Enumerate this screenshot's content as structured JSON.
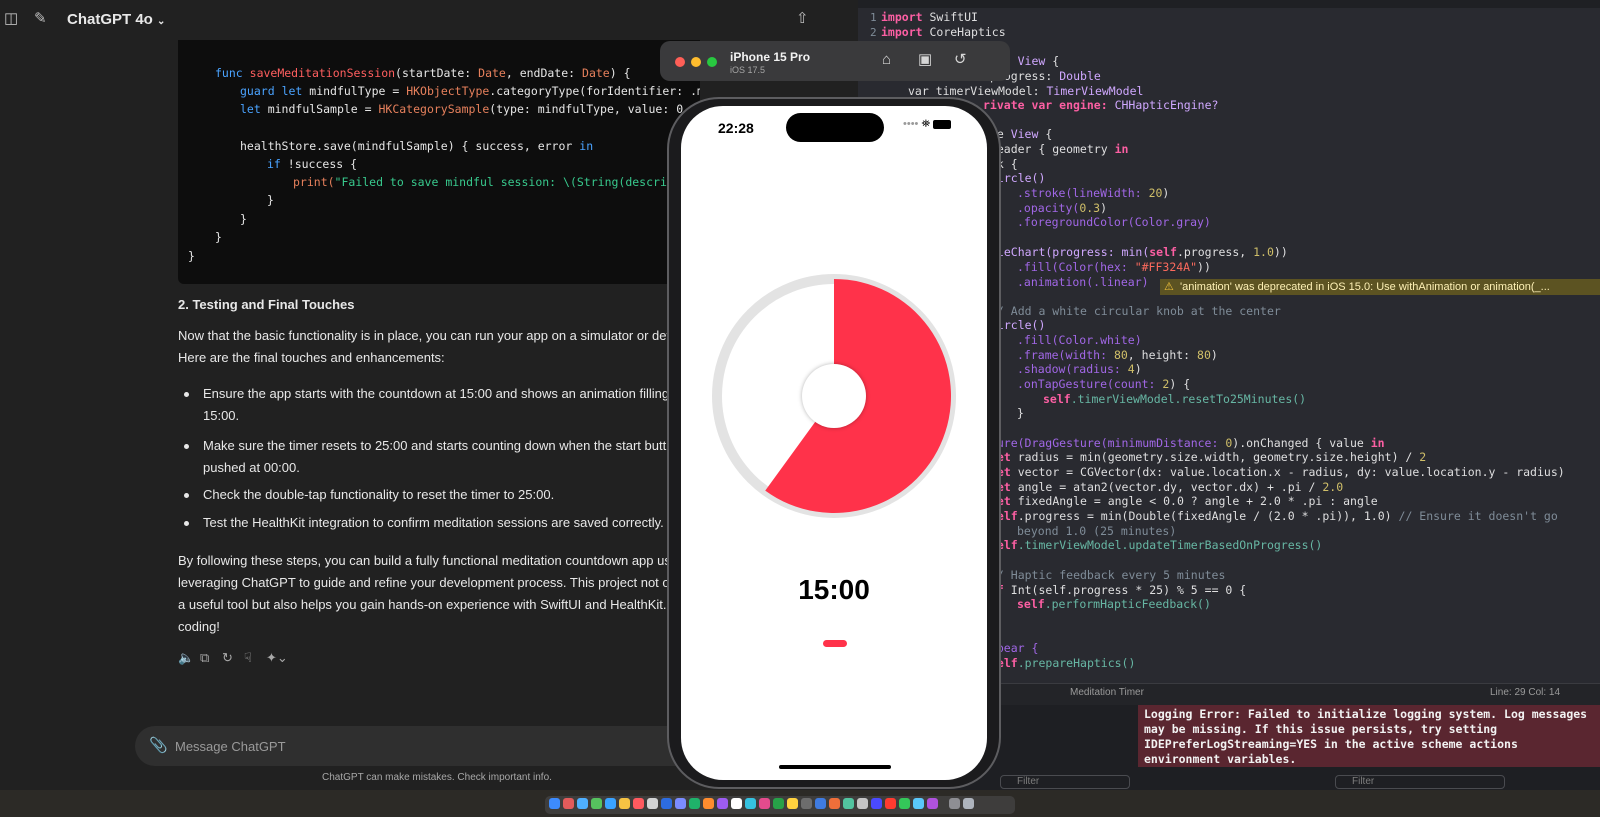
{
  "chatgpt": {
    "model": "ChatGPT 4o",
    "code": {
      "func_keyword": "func",
      "func_name": "saveMeditationSession",
      "func_args_1": "(startDate: ",
      "date_type": "Date",
      "func_args_2": ", endDate: ",
      "func_args_3": ") {",
      "guard_keyword": "guard",
      "let_keyword": "let",
      "guard_rest_1": " mindfulType = ",
      "hk_object_type": "HKObjectType",
      "guard_rest_2": ".categoryType(forIdentifier: .mindfulS",
      "sample_rest_1": " mindfulSample = ",
      "hk_category_sample": "HKCategorySample",
      "sample_rest_2": "(type: mindfulType, value: 0,",
      "save_call": "healthStore.save(mindfulSample) { success, error ",
      "in_keyword": "in",
      "if_keyword": "if",
      "if_rest": " !success {",
      "print_call": "print(",
      "print_string": "\"Failed to save mindful session: \\(String(describ",
      "brace_close": "}"
    },
    "section_heading": "2. Testing and Final Touches",
    "intro_1": "Now that the basic functionality is in place, you can run your app on a simulator or dev",
    "intro_2": "Here are the final touches and enhancements:",
    "bullets": [
      "Ensure the app starts with the countdown at 15:00 and shows an animation filling",
      "15:00.",
      "Make sure the timer resets to 25:00 and starts counting down when the start butt",
      "pushed at 00:00.",
      "Check the double-tap functionality to reset the timer to 25:00.",
      "Test the HealthKit integration to confirm meditation sessions are saved correctly."
    ],
    "closing": [
      "By following these steps, you can build a fully functional meditation countdown app us",
      "leveraging ChatGPT to guide and refine your development process. This project not o",
      "a useful tool but also helps you gain hands-on experience with SwiftUI and HealthKit.",
      "coding!"
    ],
    "composer_placeholder": "Message ChatGPT",
    "disclaimer": "ChatGPT can make mistakes. Check important info."
  },
  "xcode": {
    "line_numbers": [
      "1",
      "2"
    ],
    "code": {
      "import_keyword": "import",
      "swiftui": "SwiftUI",
      "corehaptics": "CoreHaptics",
      "l3a": "der: ",
      "view_type": "View",
      "l3b": " {",
      "l4a": "progress: ",
      "double_type": "Double",
      "l5a": "var timerViewModel: ",
      "timer_vm_type": "TimerViewModel",
      "l6a": "rivate var engine: ",
      "engine_type": "CHHapticEngine?",
      "l7a": "ome ",
      "l8a": "yReader { geometry ",
      "l9a": "ack {",
      "circle_call": "Circle()",
      "stroke_a": ".stroke(lineWidth: ",
      "stroke_num": "20",
      "opacity_a": ".opacity(",
      "opacity_num": "0.3",
      "fg_color": ".foregroundColor(Color.gray)",
      "piechart_a": "PieChart(progress: min(",
      "self_kw": "self",
      "piechart_b": ".progress, ",
      "one_num": "1.0",
      "paren_close": "))",
      "fill_a": ".fill(Color(hex: ",
      "fill_hex": "\"#FF324A\"",
      "animation_call": ".animation(.linear)",
      "knob_comment": "// Add a white circular knob at the center",
      "fill_white": ".fill(Color.white)",
      "frame_a": ".frame(width: ",
      "frame_w": "80",
      "frame_b": ", height: ",
      "frame_c": ")",
      "shadow_a": ".shadow(radius: ",
      "shadow_num": "4",
      "tap_a": ".onTapGesture(count: ",
      "tap_num": "2",
      "tap_b": ") {",
      "reset_call": ".timerViewModel.resetTo25Minutes()",
      "gesture_a": "sture(DragGesture(minimumDistance: ",
      "gesture_num": "0",
      "gesture_b": ").onChanged { value ",
      "let_kw": "let",
      "radius_line": " radius = min(geometry.size.width, geometry.size.height) / ",
      "radius_num": "2",
      "vector_line": " vector = CGVector(dx: value.location.x - radius, dy: value.location.y - radius)",
      "angle_line": " angle = atan2(vector.dy, vector.dx) + .pi / ",
      "angle_num": "2.0",
      "fixed_line": " fixedAngle = angle < 0.0 ? angle + 2.0 * .pi : angle",
      "progress_line": ".progress = min(Double(fixedAngle / (2.0 * .pi)), 1.0) ",
      "progress_comment": "// Ensure it doesn't go",
      "progress_comment_2": "beyond 1.0 (25 minutes)",
      "update_call": ".timerViewModel.updateTimerBasedOnProgress()",
      "haptic_comment": "// Haptic feedback every 5 minutes",
      "if_kw": "if",
      "haptic_line": " Int(self.progress * 25) % 5 == 0 {",
      "perform_call": ".performHapticFeedback()",
      "appear": "Appear {",
      "prepare_call": ".prepareHaptics()"
    },
    "warning": "'animation' was deprecated in iOS 15.0: Use withAnimation or animation(_...",
    "scheme": "Meditation Timer",
    "cursor": "Line: 29  Col: 14",
    "log_error": [
      "Logging Error: Failed to initialize logging system. Log messages",
      "may be missing. If this issue persists, try setting",
      "IDEPreferLogStreaming=YES in the active scheme actions",
      "environment variables."
    ],
    "filter_placeholder": "Filter"
  },
  "simulator": {
    "device": "iPhone 15 Pro",
    "ios": "iOS 17.5",
    "status_time": "22:28",
    "timer": "15:00",
    "progress_fraction": 0.6,
    "accent": "#FF324A"
  }
}
